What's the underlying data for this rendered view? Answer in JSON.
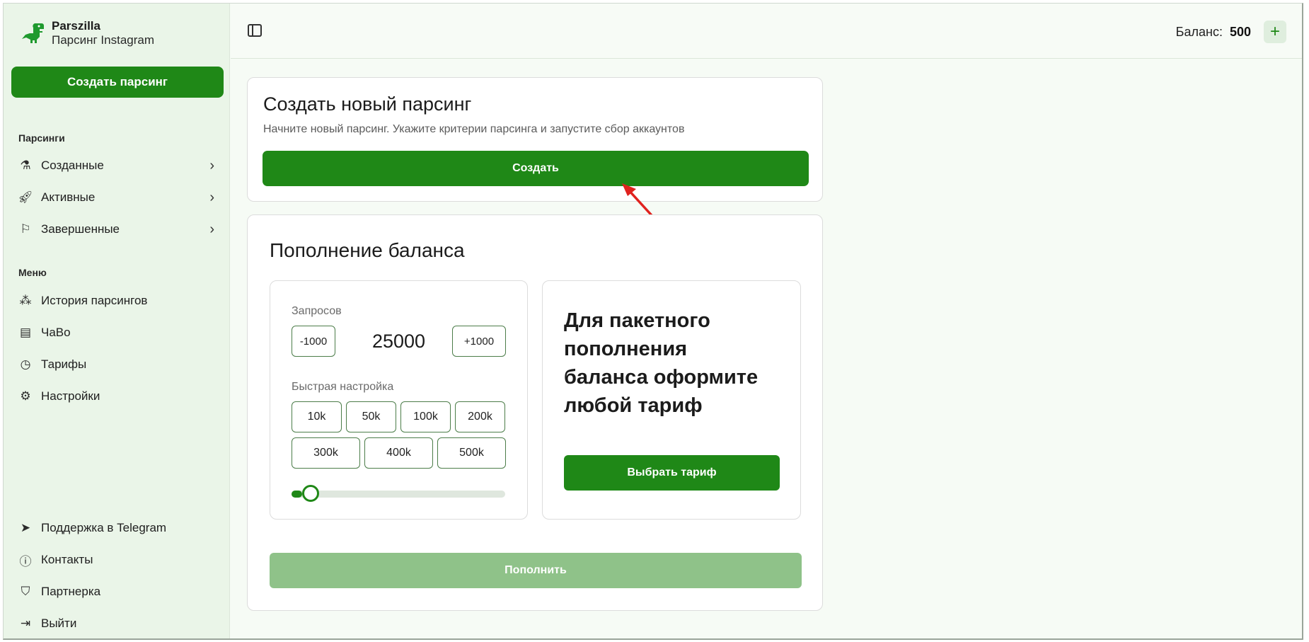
{
  "brand": {
    "name": "Parszilla",
    "subtitle": "Парсинг Instagram",
    "color": "#1f8817"
  },
  "sidebar": {
    "create_button": "Создать парсинг",
    "parsings_label": "Парсинги",
    "parsings": [
      {
        "label": "Созданные",
        "icon": "flask-icon"
      },
      {
        "label": "Активные",
        "icon": "rocket-icon"
      },
      {
        "label": "Завершенные",
        "icon": "flag-icon"
      }
    ],
    "menu_label": "Меню",
    "menu": [
      {
        "label": "История парсингов",
        "icon": "history-icon"
      },
      {
        "label": "ЧаВо",
        "icon": "book-icon"
      },
      {
        "label": "Тарифы",
        "icon": "gauge-icon"
      },
      {
        "label": "Настройки",
        "icon": "gear-icon"
      }
    ],
    "bottom": [
      {
        "label": "Поддержка в Telegram",
        "icon": "telegram-icon"
      },
      {
        "label": "Контакты",
        "icon": "info-icon"
      },
      {
        "label": "Партнерка",
        "icon": "handshake-icon"
      },
      {
        "label": "Выйти",
        "icon": "logout-icon"
      }
    ]
  },
  "header": {
    "balance_label": "Баланс:",
    "balance_value": "500",
    "add_icon": "plus-icon"
  },
  "new_parsing": {
    "title": "Создать новый парсинг",
    "description": "Начните новый парсинг. Укажите критерии парсинга и запустите сбор аккаунтов",
    "button": "Создать"
  },
  "topup": {
    "title": "Пополнение баланса",
    "requests_label": "Запросов",
    "minus_button": "-1000",
    "plus_button": "+1000",
    "requests_value": "25000",
    "quick_label": "Быстрая настройка",
    "presets_row1": [
      "10k",
      "50k",
      "100k",
      "200k"
    ],
    "presets_row2": [
      "300k",
      "400k",
      "500k"
    ],
    "slider_fraction": 0.05,
    "package_text": "Для пакетного пополнения баланса оформите любой тариф",
    "choose_tariff_button": "Выбрать тариф",
    "topup_button": "Пополнить"
  }
}
